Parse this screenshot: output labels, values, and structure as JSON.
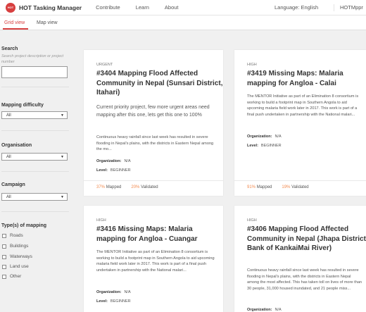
{
  "header": {
    "logo_text": "HOT",
    "brand": "HOT Tasking Manager",
    "nav": [
      "Contribute",
      "Learn",
      "About"
    ],
    "language": "Language: English",
    "user": "HOTMppr"
  },
  "tabs": [
    "Grid view",
    "Map view"
  ],
  "sidebar": {
    "search_title": "Search",
    "search_hint": "Search project description or project number",
    "search_value": "",
    "difficulty_title": "Mapping difficulty",
    "difficulty_value": "All",
    "organisation_title": "Organisation",
    "organisation_value": "All",
    "campaign_title": "Campaign",
    "campaign_value": "All",
    "types_title": "Type(s) of mapping",
    "types": [
      "Roads",
      "Buildings",
      "Waterways",
      "Land use",
      "Other"
    ]
  },
  "labels": {
    "organization": "Organization:",
    "level": "Level:",
    "mapped": "Mapped",
    "validated": "Validated"
  },
  "projects": [
    {
      "priority": "URGENT",
      "title": "#3404 Mapping Flood Affected Community in Nepal (Sunsari District, Itahari)",
      "short": "Current priority project, few more urgent areas need mapping after this one, lets get this one to 100%",
      "desc": "Continuous heavy rainfall since last week has resulted in severe flooding in Nepal's plains, with the districts in Eastern Nepal among the mo...",
      "organization": "N/A",
      "level": "BEGINNER",
      "mapped": "37%",
      "validated": "20%"
    },
    {
      "priority": "HIGH",
      "title": "#3419 Missing Maps: Malaria mapping for Angloa - Calai",
      "short": "",
      "desc": "The MENTOR Initiative as part of an Elimination 8 consortium is working to build a footprint map in Southern Angola to aid upcoming malaria field work later in 2017. This work is part of a final push undertaken in partnership with the National malari...",
      "organization": "N/A",
      "level": "BEGINNER",
      "mapped": "91%",
      "validated": "19%"
    },
    {
      "priority": "HIGH",
      "title": "#3416 Missing Maps: Malaria mapping for Angloa - Cuangar",
      "short": "",
      "desc": "The MENTOR Initiative as part of an Elimination 8 consortium is working to build a footprint map in Southern Angola to aid upcoming malaria field work later in 2017. This work is part of a final push undertaken in partnership with the National malari...",
      "organization": "N/A",
      "level": "BEGINNER",
      "mapped": "",
      "validated": ""
    },
    {
      "priority": "HIGH",
      "title": "#3406 Mapping Flood Affected Community in Nepal (Jhapa District, Bank of KankaiMai River)",
      "short": "",
      "desc": "Continuous heavy rainfall since last week has resulted in severe flooding in Nepal's plains, with the districts in Eastern Nepal among the most affected. This has taken toll on lives of more than 30 people, 31,000 housed inundated, and 21 people miss...",
      "organization": "N/A",
      "level": "",
      "mapped": "",
      "validated": ""
    }
  ],
  "colors": {
    "accent": "#d73f3f",
    "progress": "#f28b50"
  }
}
